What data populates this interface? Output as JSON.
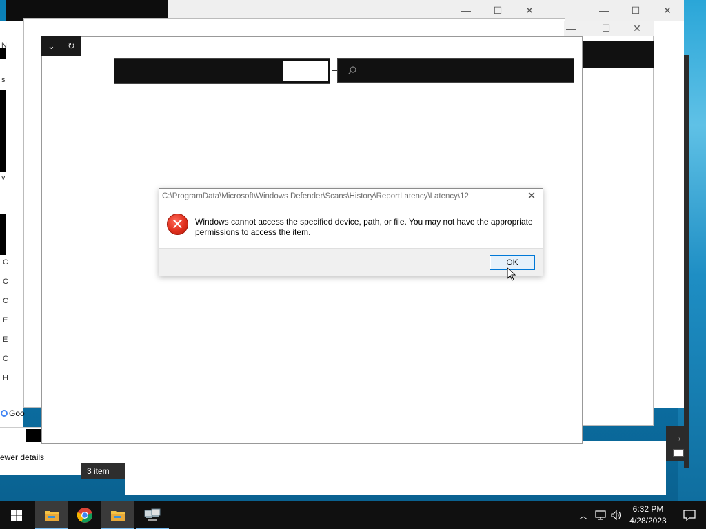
{
  "background_windows": {
    "caption_minimize": "—",
    "caption_maximize": "☐",
    "caption_close": "✕",
    "left_fragment_letters": [
      "N",
      "s",
      "v",
      "C",
      "C",
      "C",
      "E",
      "E",
      "C",
      "H"
    ],
    "google_fragment": "Goo",
    "fewer_details": "ewer details",
    "items_count": "3 item"
  },
  "main_window": {
    "toolbar": {
      "dropdown_icon": "chevron-down-icon",
      "refresh_icon": "refresh-icon"
    },
    "search_icon": "search-icon"
  },
  "dialog": {
    "title": "C:\\ProgramData\\Microsoft\\Windows Defender\\Scans\\History\\ReportLatency\\Latency\\12",
    "message": "Windows cannot access the specified device, path, or file. You may not have the appropriate permissions to access the item.",
    "ok_label": "OK",
    "icon": "error-icon"
  },
  "taskbar": {
    "items": [
      {
        "name": "start-button",
        "icon": "windows-logo-icon"
      },
      {
        "name": "file-explorer-1",
        "icon": "folder-icon",
        "active": true
      },
      {
        "name": "chrome",
        "icon": "chrome-icon"
      },
      {
        "name": "file-explorer-2",
        "icon": "folder-icon",
        "active": true
      },
      {
        "name": "network-connections",
        "icon": "network-app-icon"
      }
    ],
    "tray": {
      "chevron": "^",
      "network_icon": "network-icon",
      "volume_icon": "volume-icon",
      "notification_icon": "notification-icon"
    },
    "clock": {
      "time": "6:32 PM",
      "date": "4/28/2023"
    }
  },
  "colors": {
    "taskbar": "#101010",
    "accent": "#0078d7",
    "error_red": "#e0301e",
    "dialog_footer": "#f0f0f0",
    "desktop": "#1391c6"
  }
}
